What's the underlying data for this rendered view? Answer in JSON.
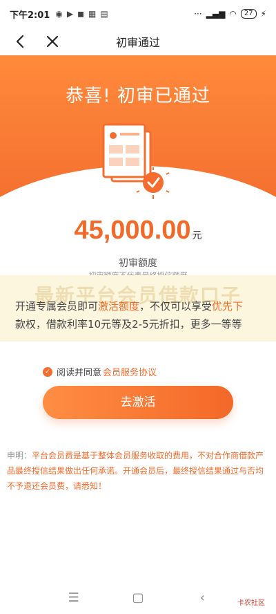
{
  "status_bar": {
    "time": "下午2:01",
    "battery": "27"
  },
  "nav": {
    "title": "初审通过"
  },
  "hero": {
    "title": "恭喜! 初审已通过"
  },
  "amount": {
    "value": "45,000.00",
    "unit": "元",
    "label": "初审额度",
    "disclaimer": "初审额度不代表最终授信额度"
  },
  "promo": {
    "watermark": "最新平台会员借款口子",
    "line1_a": "开通专属会员即可",
    "line1_hl1": "激活额度",
    "line1_b": "，不仅可以享受",
    "line1_hl2": "优先下",
    "line2_hl": "款权",
    "line2_text": "，借款利率",
    "line2_hl2": "10元",
    "line2_text2": "等及",
    "line2_hl3": "2-5",
    "line2_text3": "元折扣，更多一等等"
  },
  "agreement": {
    "prefix": "阅读并同意",
    "link": "会员服务协议"
  },
  "cta": {
    "label": "去激活"
  },
  "statement": {
    "lead": "申明：",
    "text": "平台会员费是基于整体会员服务收取的费用，不对合作商借款产品最终授信结果做出任何承诺。开通会员后，最终授信结果通过与否均不予退还会员费，请悉知！"
  },
  "footer_logo": "卡农社区"
}
